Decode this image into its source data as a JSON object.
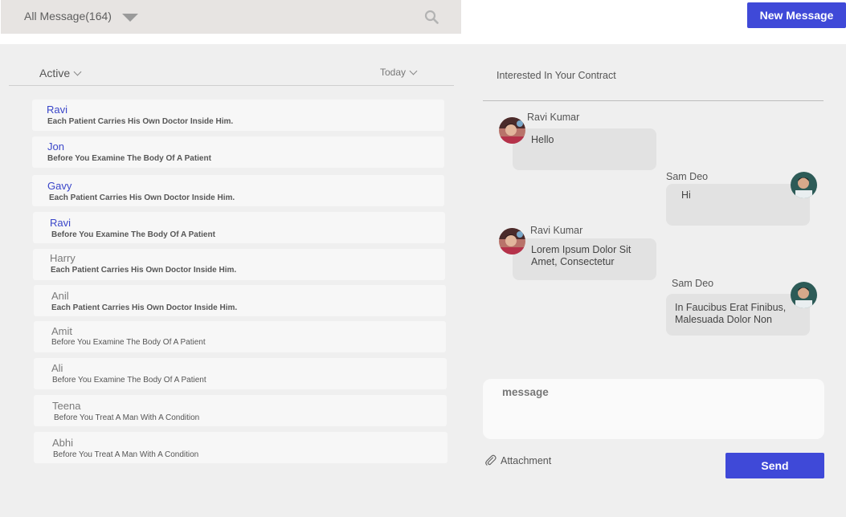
{
  "header": {
    "filter_label": "All Message(164)",
    "new_message_label": "New Message"
  },
  "list": {
    "status_filter": "Active",
    "date_filter": "Today",
    "items": [
      {
        "name": "Ravi",
        "preview": "Each Patient Carries His Own Doctor Inside Him."
      },
      {
        "name": "Jon",
        "preview": "Before You Examine The Body Of A Patient"
      },
      {
        "name": "Gavy",
        "preview": "Each Patient Carries His Own Doctor Inside Him."
      },
      {
        "name": "Ravi",
        "preview": "Before You Examine The Body Of A Patient"
      },
      {
        "name": "Harry",
        "preview": "Each Patient Carries His Own Doctor Inside Him."
      },
      {
        "name": "Anil",
        "preview": "Each Patient Carries His Own Doctor Inside Him."
      },
      {
        "name": "Amit",
        "preview": "Before You Examine The Body Of A Patient"
      },
      {
        "name": "Ali",
        "preview": "Before You Examine The Body Of A Patient"
      },
      {
        "name": "Teena",
        "preview": "Before You Treat A Man With A Condition"
      },
      {
        "name": "Abhi",
        "preview": "Before You Treat A Man With A Condition"
      }
    ]
  },
  "conversation": {
    "title": "Interested In Your Contract",
    "messages": [
      {
        "sender": "Ravi Kumar",
        "text": "Hello"
      },
      {
        "sender": "Sam Deo",
        "text": "Hi"
      },
      {
        "sender": "Ravi Kumar",
        "text": "Lorem Ipsum Dolor Sit Amet, Consectetur"
      },
      {
        "sender": "Sam Deo",
        "text": "In Faucibus Erat Finibus, Malesuada Dolor Non"
      }
    ]
  },
  "composer": {
    "placeholder": "message",
    "attachment_label": "Attachment",
    "send_label": "Send"
  },
  "colors": {
    "accent": "#3f49d8",
    "unread_name": "#3a46c9"
  }
}
